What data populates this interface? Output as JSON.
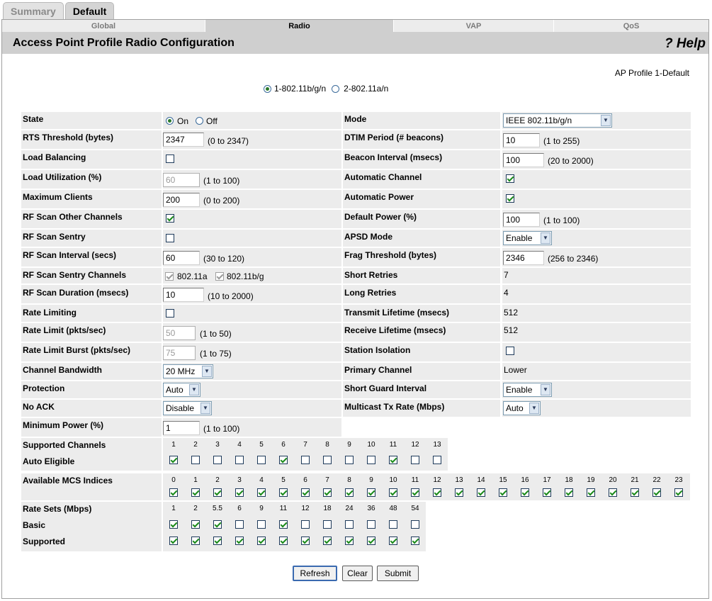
{
  "top_tabs": [
    "Summary",
    "Default"
  ],
  "sub_tabs": [
    "Global",
    "Radio",
    "VAP",
    "QoS"
  ],
  "title": "Access Point Profile Radio Configuration",
  "help": "? Help",
  "profile_label": "AP Profile 1-Default",
  "radio_options": [
    "1-802.11b/g/n",
    "2-802.11a/n"
  ],
  "left": {
    "state": {
      "label": "State",
      "on": "On",
      "off": "Off"
    },
    "rts": {
      "label": "RTS Threshold (bytes)",
      "value": "2347",
      "range": "(0 to 2347)"
    },
    "load_balancing": {
      "label": "Load Balancing"
    },
    "load_util": {
      "label": "Load Utilization (%)",
      "value": "60",
      "range": "(1 to 100)"
    },
    "max_clients": {
      "label": "Maximum Clients",
      "value": "200",
      "range": "(0 to 200)"
    },
    "rf_scan_other": {
      "label": "RF Scan Other Channels"
    },
    "rf_scan_sentry": {
      "label": "RF Scan Sentry"
    },
    "rf_scan_interval": {
      "label": "RF Scan Interval (secs)",
      "value": "60",
      "range": "(30 to 120)"
    },
    "rf_scan_sentry_channels": {
      "label": "RF Scan Sentry Channels",
      "opt1": "802.11a",
      "opt2": "802.11b/g"
    },
    "rf_scan_duration": {
      "label": "RF Scan Duration (msecs)",
      "value": "10",
      "range": "(10 to 2000)"
    },
    "rate_limiting": {
      "label": "Rate Limiting"
    },
    "rate_limit": {
      "label": "Rate Limit (pkts/sec)",
      "value": "50",
      "range": "(1 to 50)"
    },
    "rate_limit_burst": {
      "label": "Rate Limit Burst (pkts/sec)",
      "value": "75",
      "range": "(1 to 75)"
    },
    "channel_bw": {
      "label": "Channel Bandwidth",
      "value": "20 MHz"
    },
    "protection": {
      "label": "Protection",
      "value": "Auto"
    },
    "no_ack": {
      "label": "No ACK",
      "value": "Disable"
    },
    "min_power": {
      "label": "Minimum Power (%)",
      "value": "1",
      "range": "(1 to 100)"
    }
  },
  "right": {
    "mode": {
      "label": "Mode",
      "value": "IEEE 802.11b/g/n"
    },
    "dtim": {
      "label": "DTIM Period (# beacons)",
      "value": "10",
      "range": "(1 to 255)"
    },
    "beacon": {
      "label": "Beacon Interval (msecs)",
      "value": "100",
      "range": "(20 to 2000)"
    },
    "auto_channel": {
      "label": "Automatic Channel"
    },
    "auto_power": {
      "label": "Automatic Power"
    },
    "default_power": {
      "label": "Default Power (%)",
      "value": "100",
      "range": "(1 to 100)"
    },
    "apsd": {
      "label": "APSD Mode",
      "value": "Enable"
    },
    "frag": {
      "label": "Frag Threshold (bytes)",
      "value": "2346",
      "range": "(256 to 2346)"
    },
    "short_retries": {
      "label": "Short Retries",
      "value": "7"
    },
    "long_retries": {
      "label": "Long Retries",
      "value": "4"
    },
    "tx_lifetime": {
      "label": "Transmit Lifetime (msecs)",
      "value": "512"
    },
    "rx_lifetime": {
      "label": "Receive Lifetime (msecs)",
      "value": "512"
    },
    "station_isolation": {
      "label": "Station Isolation"
    },
    "primary_channel": {
      "label": "Primary Channel",
      "value": "Lower"
    },
    "sgi": {
      "label": "Short Guard Interval",
      "value": "Enable"
    },
    "mcast_rate": {
      "label": "Multicast Tx Rate (Mbps)",
      "value": "Auto"
    }
  },
  "channels": {
    "label": "Supported Channels",
    "eligible_label": "Auto Eligible",
    "numbers": [
      "1",
      "2",
      "3",
      "4",
      "5",
      "6",
      "7",
      "8",
      "9",
      "10",
      "11",
      "12",
      "13"
    ],
    "eligible": [
      true,
      false,
      false,
      false,
      false,
      true,
      false,
      false,
      false,
      false,
      true,
      false,
      false
    ]
  },
  "mcs": {
    "label": "Available MCS Indices",
    "numbers": [
      "0",
      "1",
      "2",
      "3",
      "4",
      "5",
      "6",
      "7",
      "8",
      "9",
      "10",
      "11",
      "12",
      "13",
      "14",
      "15",
      "16",
      "17",
      "18",
      "19",
      "20",
      "21",
      "22",
      "23"
    ],
    "checked": [
      true,
      true,
      true,
      true,
      true,
      true,
      true,
      true,
      true,
      true,
      true,
      true,
      true,
      true,
      true,
      true,
      true,
      true,
      true,
      true,
      true,
      true,
      true,
      true
    ]
  },
  "rates": {
    "label": "Rate Sets (Mbps)",
    "basic_label": "Basic",
    "supported_label": "Supported",
    "numbers": [
      "1",
      "2",
      "5.5",
      "6",
      "9",
      "11",
      "12",
      "18",
      "24",
      "36",
      "48",
      "54"
    ],
    "basic": [
      true,
      true,
      true,
      false,
      false,
      true,
      false,
      false,
      false,
      false,
      false,
      false
    ],
    "supported": [
      true,
      true,
      true,
      true,
      true,
      true,
      true,
      true,
      true,
      true,
      true,
      true
    ]
  },
  "buttons": {
    "refresh": "Refresh",
    "clear": "Clear",
    "submit": "Submit"
  }
}
